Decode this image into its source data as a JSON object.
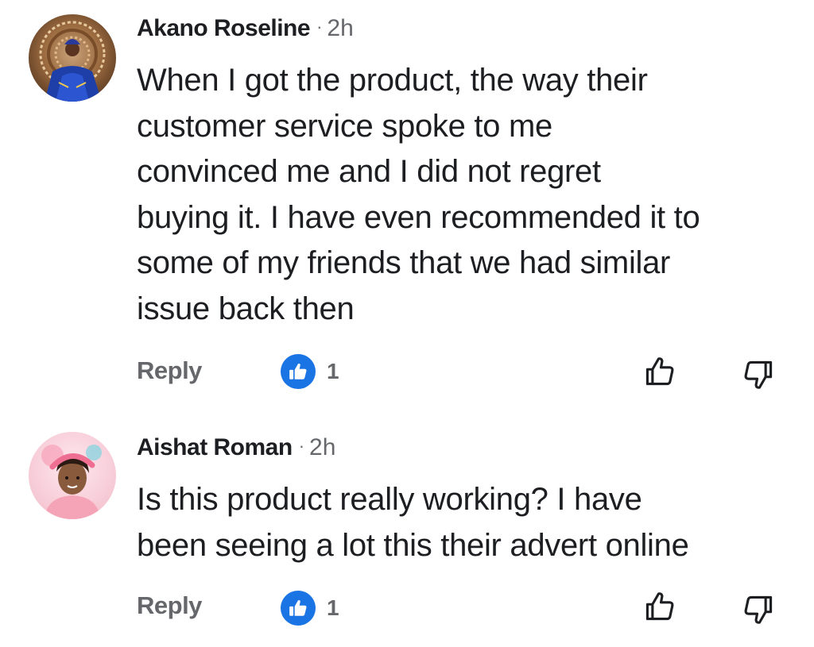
{
  "comments": [
    {
      "author": "Akano Roseline",
      "separator": "·",
      "time": "2h",
      "text_lines": [
        "When I got the product, the way their",
        "customer service spoke to me",
        "convinced me and I did not regret",
        "buying it. I have even recommended it to",
        "some of my friends that we had similar",
        "issue back then"
      ],
      "reply_label": "Reply",
      "reaction_count": "1",
      "reaction_icon": "thumbs-up-icon",
      "upvote_icon": "thumbs-up-outline-icon",
      "downvote_icon": "thumbs-down-outline-icon"
    },
    {
      "author": "Aishat Roman",
      "separator": "·",
      "time": "2h",
      "text_lines": [
        "Is this product really working? I have",
        "been seeing a lot this their advert online"
      ],
      "reply_label": "Reply",
      "reaction_count": "1",
      "reaction_icon": "thumbs-up-icon",
      "upvote_icon": "thumbs-up-outline-icon",
      "downvote_icon": "thumbs-down-outline-icon"
    }
  ],
  "colors": {
    "text_primary": "#1c1e21",
    "text_secondary": "#65676b",
    "like_blue": "#1b74e4"
  }
}
